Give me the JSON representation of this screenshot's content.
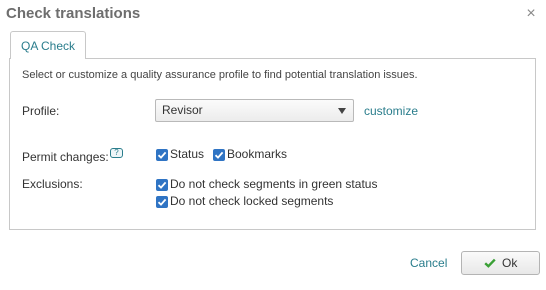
{
  "dialog": {
    "title": "Check translations",
    "close_glyph": "×"
  },
  "tabs": [
    {
      "label": "QA Check",
      "active": true
    }
  ],
  "panel": {
    "description": "Select or customize a quality assurance profile to find potential translation issues.",
    "profile_label": "Profile:",
    "profile_value": "Revisor",
    "customize_link": "customize",
    "permit_label": "Permit changes:",
    "help_glyph": "?",
    "permit_options": [
      {
        "label": "Status",
        "checked": true
      },
      {
        "label": "Bookmarks",
        "checked": true
      }
    ],
    "exclusions_label": "Exclusions:",
    "exclusion_options": [
      {
        "label": "Do not check segments in green status",
        "checked": true
      },
      {
        "label": "Do not check locked segments",
        "checked": true
      }
    ]
  },
  "footer": {
    "cancel_label": "Cancel",
    "ok_label": "Ok"
  },
  "colors": {
    "accent": "#2a7d8c",
    "checkbox": "#2f74c4",
    "ok_check": "#3aa035"
  },
  "icons": [
    "close-icon",
    "help-icon",
    "chevron-down-icon",
    "checkmark-icon"
  ]
}
